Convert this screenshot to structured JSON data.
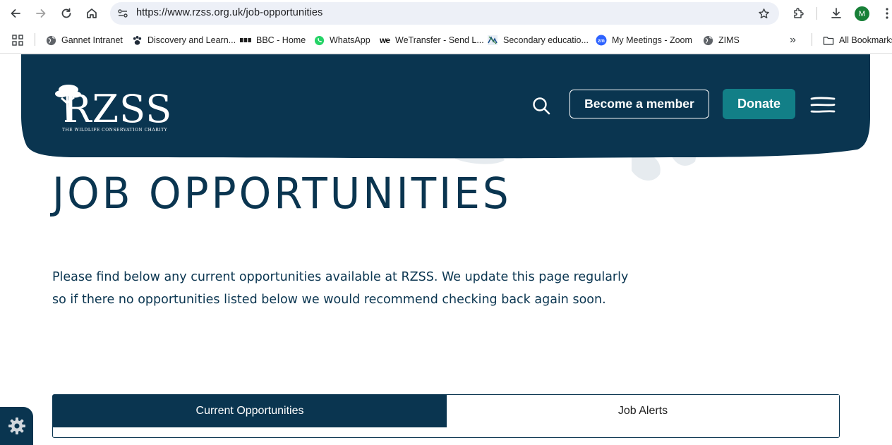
{
  "browser": {
    "url": "https://www.rzss.org.uk/job-opportunities",
    "profile_initial": "M"
  },
  "bookmarks": [
    {
      "label": "Gannet Intranet",
      "icon": "globe-icon"
    },
    {
      "label": "Discovery and Learn...",
      "icon": "paw-icon"
    },
    {
      "label": "BBC - Home",
      "icon": "bbc-icon"
    },
    {
      "label": "WhatsApp",
      "icon": "whatsapp-icon"
    },
    {
      "label": "WeTransfer - Send L...",
      "icon": "wetransfer-icon"
    },
    {
      "label": "Secondary educatio...",
      "icon": "school-icon"
    },
    {
      "label": "My Meetings - Zoom",
      "icon": "zoom-icon"
    },
    {
      "label": "ZIMS",
      "icon": "globe-icon"
    }
  ],
  "bookmarks_overflow": "»",
  "all_bookmarks_label": "All Bookmarks",
  "header": {
    "logo_text": "RZSS",
    "logo_tagline": "THE WILDLIFE CONSERVATION CHARITY",
    "member_label": "Become a member",
    "donate_label": "Donate"
  },
  "main": {
    "title": "JOB OPPORTUNITIES",
    "intro": "Please find below any current opportunities available at RZSS. We update this page regularly so if there no opportunities listed below we would recommend checking back again soon.",
    "tabs": [
      {
        "label": "Current Opportunities",
        "active": true
      },
      {
        "label": "Job Alerts",
        "active": false
      }
    ]
  },
  "colors": {
    "navy": "#0a3550",
    "teal": "#127f87"
  }
}
